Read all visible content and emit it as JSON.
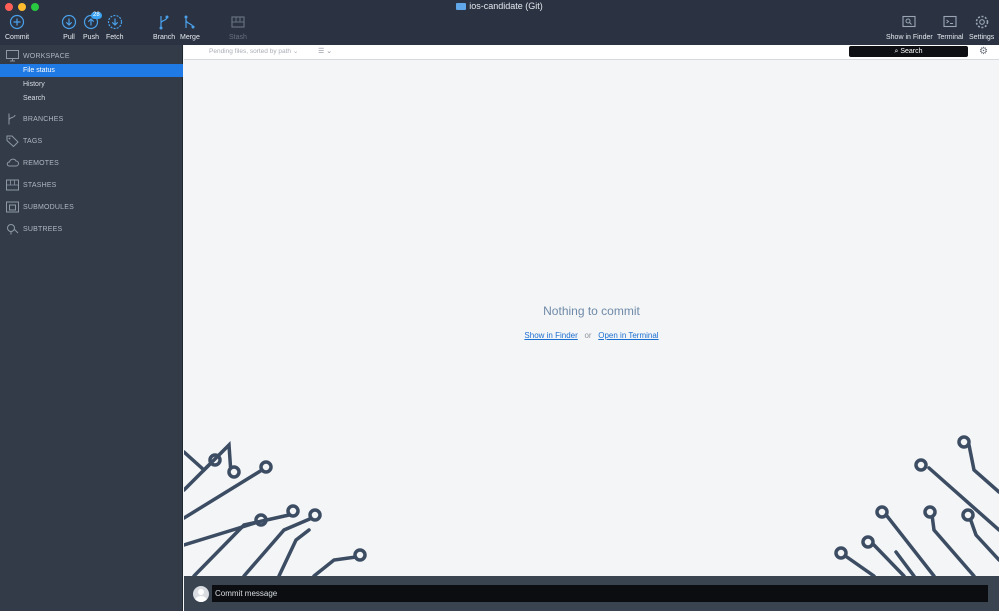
{
  "window": {
    "title": "ios-candidate (Git)"
  },
  "toolbar": {
    "commit": "Commit",
    "pull": "Pull",
    "push": "Push",
    "push_badge": "28",
    "fetch": "Fetch",
    "branch": "Branch",
    "merge": "Merge",
    "stash": "Stash",
    "show_in_finder": "Show in Finder",
    "terminal": "Terminal",
    "settings": "Settings"
  },
  "sidebar": {
    "workspace": "WORKSPACE",
    "items": [
      "File status",
      "History",
      "Search"
    ],
    "branches": "BRANCHES",
    "tags": "TAGS",
    "remotes": "REMOTES",
    "stashes": "STASHES",
    "submodules": "SUBMODULES",
    "subtrees": "SUBTREES"
  },
  "filterbar": {
    "pending": "Pending files, sorted by path",
    "search_label": "Search"
  },
  "main": {
    "empty_message": "Nothing to commit",
    "show_in_finder": "Show in Finder",
    "or": "or",
    "open_in_terminal": "Open in Terminal"
  },
  "commit": {
    "placeholder": "Commit message"
  },
  "colors": {
    "toolbar": "#2b3342",
    "sidebar": "#333b48",
    "accent": "#1f7ae6",
    "circuit": "#3b4c63"
  }
}
